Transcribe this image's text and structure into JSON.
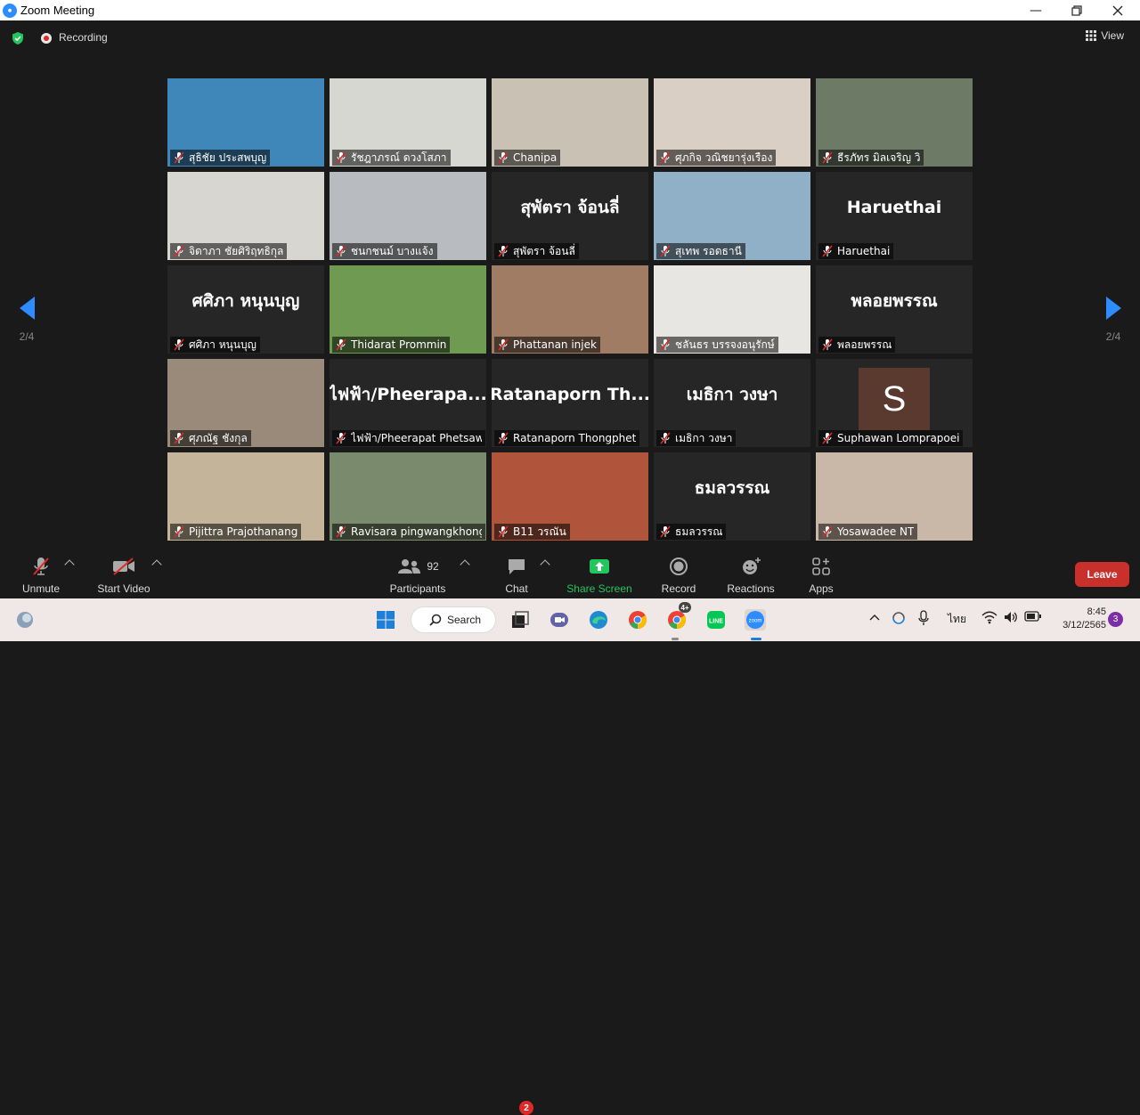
{
  "window": {
    "title": "Zoom Meeting"
  },
  "status": {
    "recording_label": "Recording",
    "view_label": "View"
  },
  "pager": {
    "left_label": "2/4",
    "right_label": "2/4"
  },
  "participants": [
    {
      "name": "สุธิชัย ประสพบุญ",
      "type": "video",
      "bg": "#3f87b8"
    },
    {
      "name": "รัชฎาภรณ์ ดวงโสภา",
      "type": "video",
      "bg": "#d7d7d2"
    },
    {
      "name": "Chanipa",
      "type": "video",
      "bg": "#c9c2b4"
    },
    {
      "name": "ศุภกิจ วณิชยารุ่งเรือง",
      "type": "video",
      "bg": "#d9cfc4"
    },
    {
      "name": "ธีรภัทร มิลเจริญ วิ",
      "type": "video",
      "bg": "#6d7a66"
    },
    {
      "name": "จิดาภา ชัยศิริฤทธิกุล",
      "type": "video",
      "bg": "#d8d6d0"
    },
    {
      "name": "ชนกชนม์ บางแจ้ง",
      "type": "video",
      "bg": "#b8bcc0"
    },
    {
      "name": "สุพัตรา จ้อนลี่",
      "type": "name",
      "display": "สุพัตรา จ้อนลี่"
    },
    {
      "name": "สุเทพ รอดธานี",
      "type": "video",
      "bg": "#8fb0c7"
    },
    {
      "name": "Haruethai",
      "type": "name",
      "display": "Haruethai"
    },
    {
      "name": "ศศิภา หนุนบุญ",
      "type": "name",
      "display": "ศศิภา หนุนบุญ"
    },
    {
      "name": "Thidarat Prommin",
      "type": "video",
      "bg": "#6f9a52"
    },
    {
      "name": "Phattanan injek",
      "type": "video",
      "bg": "#a07c64"
    },
    {
      "name": "ชลันธร บรรจงอนุรักษ์",
      "type": "video",
      "bg": "#e8e6e3"
    },
    {
      "name": "พลอยพรรณ",
      "type": "name",
      "display": "พลอยพรรณ"
    },
    {
      "name": "ศุภณัฐ ชังกุล",
      "type": "video",
      "bg": "#9a8a7a"
    },
    {
      "name": "ไฟฟ้า/Pheerapat Phetsawat",
      "type": "name",
      "display": "ไฟฟ้า/Pheerapa..."
    },
    {
      "name": "Ratanaporn Thongphet",
      "type": "name",
      "display": "Ratanaporn  Th..."
    },
    {
      "name": "เมธิกา วงษา",
      "type": "name",
      "display": "เมธิกา  วงษา"
    },
    {
      "name": "Suphawan Lomprapoei",
      "type": "avatar",
      "initial": "S"
    },
    {
      "name": "Pijittra Prajothanang",
      "type": "video",
      "bg": "#c4b59a"
    },
    {
      "name": "Ravisara pingwangkhong",
      "type": "video",
      "bg": "#7a8a6c"
    },
    {
      "name": "B11 วรณัน",
      "type": "video",
      "bg": "#b0553c"
    },
    {
      "name": "ธมลวรรณ",
      "type": "name",
      "display": "ธมลวรรณ"
    },
    {
      "name": "Yosawadee NT",
      "type": "video",
      "bg": "#c9b8a8"
    }
  ],
  "toolbar": {
    "unmute": "Unmute",
    "start_video": "Start Video",
    "participants": "Participants",
    "participants_count": "92",
    "chat": "Chat",
    "chat_badge": "2",
    "share_screen": "Share Screen",
    "record": "Record",
    "reactions": "Reactions",
    "apps": "Apps",
    "leave": "Leave"
  },
  "taskbar": {
    "search_label": "Search",
    "language": "ไทย",
    "time": "8:45",
    "date": "3/12/2565",
    "notification_count": "3",
    "chrome_badge": "4+"
  },
  "colors": {
    "accent": "#2d8cff",
    "leave": "#c9302c",
    "share_green": "#23c55e",
    "mic_red": "#e02828"
  }
}
